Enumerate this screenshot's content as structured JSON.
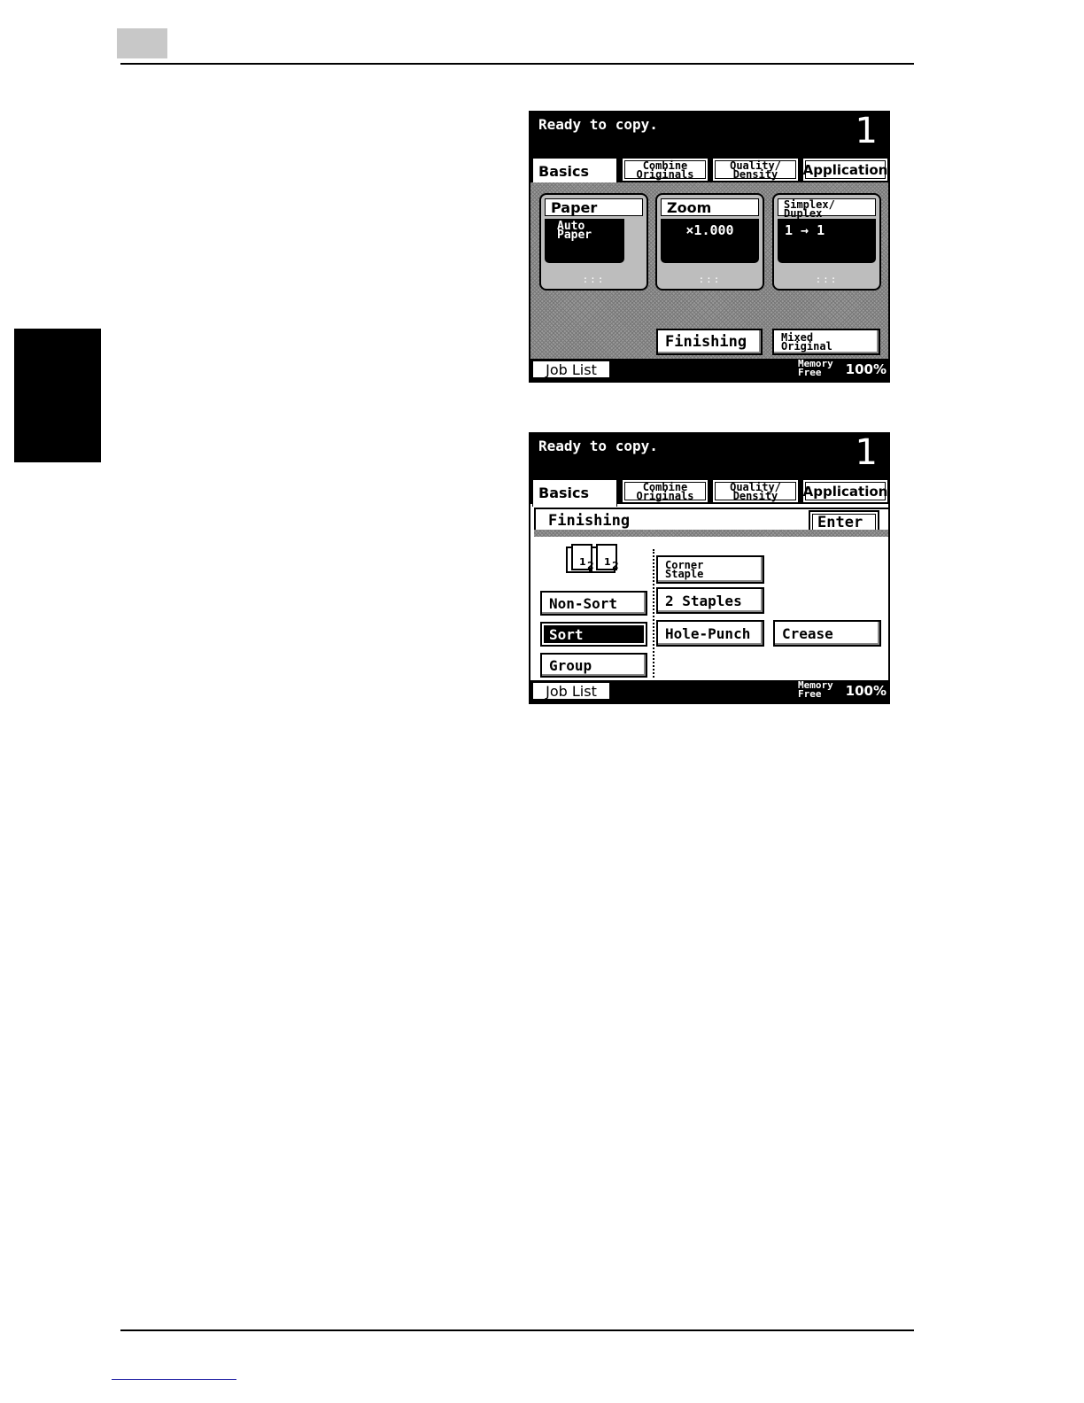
{
  "screen1": {
    "status": "Ready to copy.",
    "copies": "1",
    "tabs": [
      "Basics",
      "Combine Originals",
      "Quality/ Density",
      "Application"
    ],
    "cards": [
      {
        "label": "Paper",
        "value": "Auto Paper",
        "dots": ":::"
      },
      {
        "label": "Zoom",
        "value": "×1.000",
        "dots": ":::"
      },
      {
        "label": "Simplex/ Duplex",
        "value": "1 → 1",
        "dots": ":::"
      }
    ],
    "buttons": {
      "finishing": "Finishing",
      "mixed_original": "Mixed Original"
    },
    "footer": {
      "job_list": "Job List",
      "memory_label": "Memory Free",
      "memory_value": "100%"
    }
  },
  "screen2": {
    "status": "Ready to copy.",
    "copies": "1",
    "tabs": [
      "Basics",
      "Combine Originals",
      "Quality/ Density",
      "Application"
    ],
    "title": "Finishing",
    "enter": "Enter",
    "sort_options": [
      "Non-Sort",
      "Sort",
      "Group"
    ],
    "selected_sort": "Sort",
    "staple_options": {
      "corner": "Corner Staple",
      "two": "2 Staples"
    },
    "hole_punch": "Hole-Punch",
    "crease": "Crease",
    "icon_digits": [
      "1",
      "2",
      "1",
      "2"
    ],
    "footer": {
      "job_list": "Job List",
      "memory_label": "Memory Free",
      "memory_value": "100%"
    }
  }
}
